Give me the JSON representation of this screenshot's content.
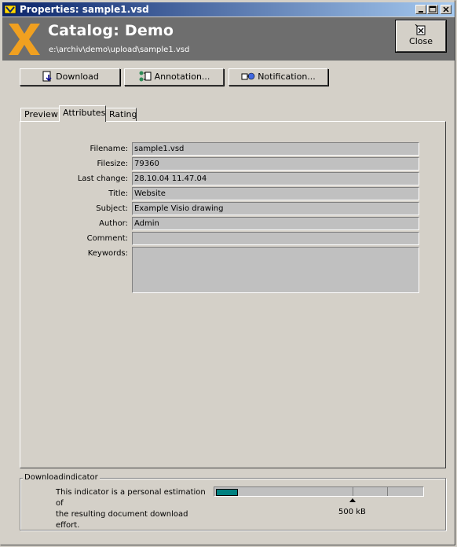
{
  "window": {
    "title": "Properties: sample1.vsd"
  },
  "header": {
    "catalog_title": "Catalog: Demo",
    "path": "e:\\archiv\\demo\\upload\\sample1.vsd",
    "close_label": "Close"
  },
  "toolbar": {
    "download_label": "Download",
    "annotation_label": "Annotation...",
    "notification_label": "Notification..."
  },
  "tabs": [
    {
      "label": "Preview"
    },
    {
      "label": "Attributes",
      "active": true
    },
    {
      "label": "Rating"
    }
  ],
  "attributes": {
    "filename": {
      "label": "Filename:",
      "value": "sample1.vsd"
    },
    "filesize": {
      "label": "Filesize:",
      "value": "79360"
    },
    "last_change": {
      "label": "Last change:",
      "value": "28.10.04 11.47.04"
    },
    "title": {
      "label": "Title:",
      "value": "Website"
    },
    "subject": {
      "label": "Subject:",
      "value": "Example Visio drawing"
    },
    "author": {
      "label": "Author:",
      "value": "Admin"
    },
    "comment": {
      "label": "Comment:",
      "value": ""
    },
    "keywords": {
      "label": "Keywords:",
      "value": ""
    }
  },
  "download_indicator": {
    "legend": "Downloadindicator",
    "description_line1": "This indicator is a personal estimation of",
    "description_line2": "the resulting document download effort.",
    "marker_label": "500 kB",
    "fill_fraction": 0.1
  },
  "colors": {
    "header_bg": "#6e6e6e",
    "logo": "#f0a020",
    "indicator_fill": "#008080",
    "titlebar": "#0a246a"
  }
}
